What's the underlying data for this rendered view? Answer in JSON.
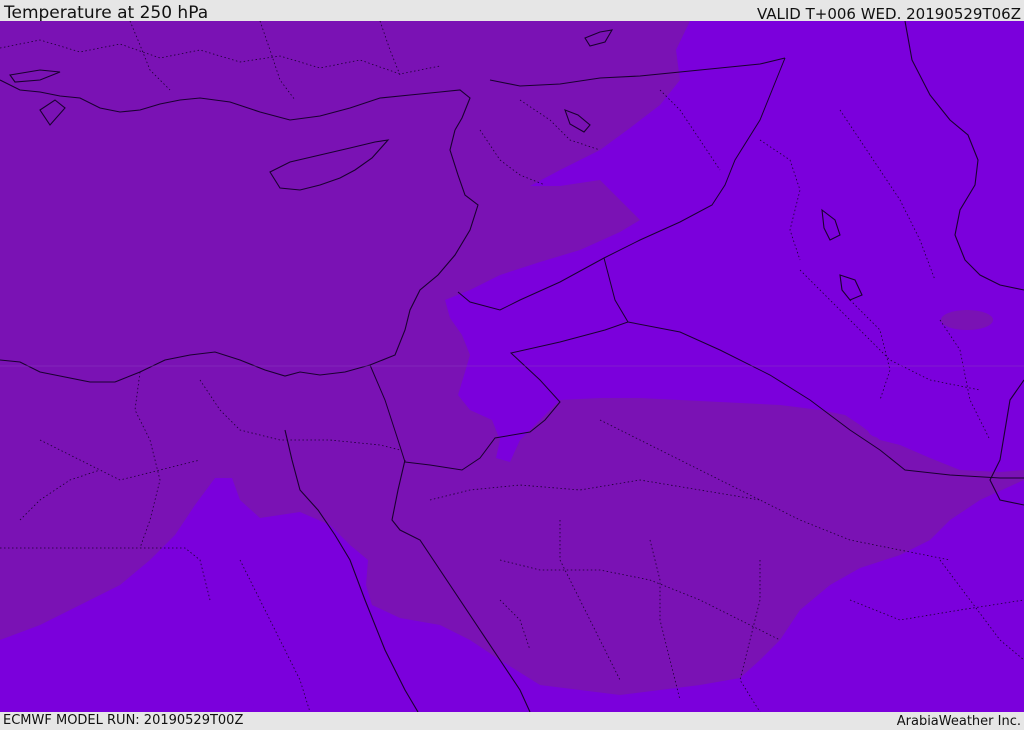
{
  "header": {
    "title": "Temperature at 250 hPa",
    "valid_time": "VALID T+006 WED. 20190529T06Z"
  },
  "footer": {
    "model_run": "ECMWF MODEL RUN: 20190529T00Z",
    "credit": "ArabiaWeather Inc."
  },
  "map": {
    "region": "Eastern Mediterranean and Middle East",
    "colors": {
      "cold_zone": "#7a12b4",
      "colder_zone": "#7b00dc",
      "coastline": "#1a0030",
      "border": "#1a0030"
    }
  }
}
